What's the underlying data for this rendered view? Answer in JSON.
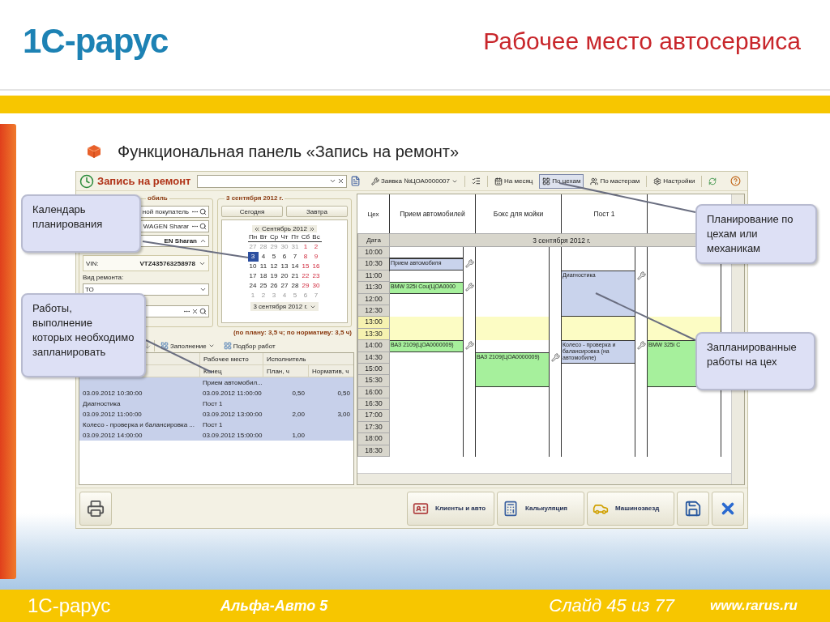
{
  "slide": {
    "logo": "1С-рарус",
    "title": "Рабочее место автосервиса",
    "bullet": "Функциональная панель «Запись на ремонт»"
  },
  "window": {
    "title": "Запись на ремонт",
    "request": "Заявка №ЦОА0000007",
    "views": [
      {
        "label": "На месяц",
        "selected": false
      },
      {
        "label": "По цехам",
        "selected": true
      },
      {
        "label": "По мастерам",
        "selected": false
      }
    ],
    "settings": "Настройки"
  },
  "car": {
    "group_label": "обиль",
    "customer": "ной покупатель",
    "car": "WAGEN Sharar",
    "model": "EN Sharan",
    "vin_label": "VIN:",
    "vin": "VTZ435763258978",
    "repair_label": "Вид ремонта:",
    "repair": "ТО"
  },
  "calendar": {
    "group_label": "3 сентября 2012 г.",
    "buttons": [
      "Сегодня",
      "Завтра"
    ],
    "month": "Сентябрь 2012",
    "weekdays": [
      "Пн",
      "Вт",
      "Ср",
      "Чт",
      "Пт",
      "Сб",
      "Вс"
    ],
    "weeks": [
      [
        {
          "d": "27",
          "kind": "other",
          "selected": false
        },
        {
          "d": "28",
          "kind": "other",
          "selected": false
        },
        {
          "d": "29",
          "kind": "other",
          "selected": false
        },
        {
          "d": "30",
          "kind": "other",
          "selected": false
        },
        {
          "d": "31",
          "kind": "other",
          "selected": false
        },
        {
          "d": "1",
          "kind": "weekend",
          "selected": false
        },
        {
          "d": "2",
          "kind": "weekend",
          "selected": false
        }
      ],
      [
        {
          "d": "3",
          "kind": "work",
          "selected": true
        },
        {
          "d": "4",
          "kind": "work",
          "selected": false
        },
        {
          "d": "5",
          "kind": "work",
          "selected": false
        },
        {
          "d": "6",
          "kind": "work",
          "selected": false
        },
        {
          "d": "7",
          "kind": "work",
          "selected": false
        },
        {
          "d": "8",
          "kind": "weekend",
          "selected": false
        },
        {
          "d": "9",
          "kind": "weekend",
          "selected": false
        }
      ],
      [
        {
          "d": "10",
          "kind": "work",
          "selected": false
        },
        {
          "d": "11",
          "kind": "work",
          "selected": false
        },
        {
          "d": "12",
          "kind": "work",
          "selected": false
        },
        {
          "d": "13",
          "kind": "work",
          "selected": false
        },
        {
          "d": "14",
          "kind": "work",
          "selected": false
        },
        {
          "d": "15",
          "kind": "weekend",
          "selected": false
        },
        {
          "d": "16",
          "kind": "weekend",
          "selected": false
        }
      ],
      [
        {
          "d": "17",
          "kind": "work",
          "selected": false
        },
        {
          "d": "18",
          "kind": "work",
          "selected": false
        },
        {
          "d": "19",
          "kind": "work",
          "selected": false
        },
        {
          "d": "20",
          "kind": "work",
          "selected": false
        },
        {
          "d": "21",
          "kind": "work",
          "selected": false
        },
        {
          "d": "22",
          "kind": "weekend",
          "selected": false
        },
        {
          "d": "23",
          "kind": "weekend",
          "selected": false
        }
      ],
      [
        {
          "d": "24",
          "kind": "work",
          "selected": false
        },
        {
          "d": "25",
          "kind": "work",
          "selected": false
        },
        {
          "d": "26",
          "kind": "work",
          "selected": false
        },
        {
          "d": "27",
          "kind": "work",
          "selected": false
        },
        {
          "d": "28",
          "kind": "work",
          "selected": false
        },
        {
          "d": "29",
          "kind": "weekend",
          "selected": false
        },
        {
          "d": "30",
          "kind": "weekend",
          "selected": false
        }
      ],
      [
        {
          "d": "1",
          "kind": "other",
          "selected": false
        },
        {
          "d": "2",
          "kind": "other",
          "selected": false
        },
        {
          "d": "3",
          "kind": "other",
          "selected": false
        },
        {
          "d": "4",
          "kind": "other",
          "selected": false
        },
        {
          "d": "5",
          "kind": "other",
          "selected": false
        },
        {
          "d": "6",
          "kind": "other",
          "selected": false
        },
        {
          "d": "7",
          "kind": "other",
          "selected": false
        }
      ]
    ],
    "footer": "3 сентября 2012 г."
  },
  "works": {
    "summary": "(по плану: 3,5 ч; по нормативу: 3,5 ч)",
    "tools": [
      "Заполнение",
      "Подбор работ"
    ],
    "header_1": [
      "Рабочее место",
      "Исполнитель"
    ],
    "header_2": [
      "Конец",
      "План, ч",
      "Норматив, ч"
    ],
    "rows": [
      {
        "selected": true,
        "cells": {
          "c2": "Прием автомобил..."
        }
      },
      {
        "selected": true,
        "cells": {
          "c1": "03.09.2012 10:30:00",
          "c2": "03.09.2012 11:00:00",
          "c3": "0,50",
          "c4": "0,50"
        }
      },
      {
        "selected": true,
        "cells": {
          "c1": "Диагностика",
          "c2": "Пост 1"
        }
      },
      {
        "selected": true,
        "cells": {
          "c1": "03.09.2012 11:00:00",
          "c2": "03.09.2012 13:00:00",
          "c3": "2,00",
          "c4": "3,00"
        }
      },
      {
        "selected": true,
        "cells": {
          "c1": "Колесо - проверка и балансировка ...",
          "c2": "Пост 1"
        }
      },
      {
        "selected": true,
        "cells": {
          "c1": "03.09.2012 14:00:00",
          "c2": "03.09.2012 15:00:00",
          "c3": "1,00"
        }
      }
    ]
  },
  "schedule": {
    "corner": "Цех",
    "date_label": "Дата",
    "date": "3 сентября 2012 г.",
    "times": [
      {
        "label": "10:00",
        "lunch": false
      },
      {
        "label": "10:30",
        "lunch": false
      },
      {
        "label": "11:00",
        "lunch": false
      },
      {
        "label": "11:30",
        "lunch": false
      },
      {
        "label": "12:00",
        "lunch": false
      },
      {
        "label": "12:30",
        "lunch": false
      },
      {
        "label": "13:00",
        "lunch": true
      },
      {
        "label": "13:30",
        "lunch": true
      },
      {
        "label": "14:00",
        "lunch": false
      },
      {
        "label": "14:30",
        "lunch": false
      },
      {
        "label": "15:00",
        "lunch": false
      },
      {
        "label": "15:30",
        "lunch": false
      },
      {
        "label": "16:00",
        "lunch": false
      },
      {
        "label": "16:30",
        "lunch": false
      },
      {
        "label": "17:00",
        "lunch": false
      },
      {
        "label": "17:30",
        "lunch": false
      },
      {
        "label": "18:00",
        "lunch": false
      },
      {
        "label": "18:30",
        "lunch": false
      }
    ],
    "shops": [
      {
        "name": "Прием автомобилей",
        "slots": [
          {
            "kind": "free"
          },
          {
            "kind": "work",
            "label": "Прием автомобиля",
            "color": "#c9d3ec",
            "selected": true
          },
          {
            "kind": "free"
          },
          {
            "kind": "work",
            "label": "BMW 325i Cou(ЦОА0000",
            "color": "#a6f09c",
            "selected": false
          },
          {
            "kind": "free"
          },
          {
            "kind": "free"
          },
          {
            "kind": "free"
          },
          {
            "kind": "free"
          },
          {
            "kind": "work",
            "label": "ВАЗ 2109(ЦОА0000009)",
            "color": "#a6f09c",
            "selected": false
          },
          {
            "kind": "free"
          },
          {
            "kind": "free"
          },
          {
            "kind": "free"
          },
          {
            "kind": "free"
          },
          {
            "kind": "free"
          },
          {
            "kind": "free"
          },
          {
            "kind": "free"
          },
          {
            "kind": "free"
          },
          {
            "kind": "free"
          }
        ]
      },
      {
        "name": "Бокс для мойки",
        "slots": [
          {
            "kind": "free"
          },
          {
            "kind": "free"
          },
          {
            "kind": "free"
          },
          {
            "kind": "free"
          },
          {
            "kind": "free"
          },
          {
            "kind": "free"
          },
          {
            "kind": "free"
          },
          {
            "kind": "free"
          },
          {
            "kind": "free"
          },
          {
            "kind": "work",
            "label": "ВАЗ 2109(ЦОА0000009)",
            "color": "#a6f09c",
            "selected": false
          },
          {
            "kind": "more"
          },
          {
            "kind": "more"
          },
          {
            "kind": "free"
          },
          {
            "kind": "free"
          },
          {
            "kind": "free"
          },
          {
            "kind": "free"
          },
          {
            "kind": "free"
          },
          {
            "kind": "free"
          }
        ]
      },
      {
        "name": "Пост 1",
        "slots": [
          {
            "kind": "free"
          },
          {
            "kind": "free"
          },
          {
            "kind": "work",
            "label": "Диагностика",
            "color": "#c9d3ec",
            "selected": false
          },
          {
            "kind": "more"
          },
          {
            "kind": "more"
          },
          {
            "kind": "more"
          },
          {
            "kind": "free"
          },
          {
            "kind": "free"
          },
          {
            "kind": "work",
            "label": "Колесо - проверка и балансировка (на автомобиле)",
            "color": "#c9d3ec",
            "selected": false
          },
          {
            "kind": "more"
          },
          {
            "kind": "free"
          },
          {
            "kind": "free"
          },
          {
            "kind": "free"
          },
          {
            "kind": "free"
          },
          {
            "kind": "free"
          },
          {
            "kind": "free"
          },
          {
            "kind": "free"
          },
          {
            "kind": "free"
          }
        ]
      },
      {
        "slots": [
          {
            "kind": "free"
          },
          {
            "kind": "free"
          },
          {
            "kind": "free"
          },
          {
            "kind": "free"
          },
          {
            "kind": "free"
          },
          {
            "kind": "free"
          },
          {
            "kind": "free"
          },
          {
            "kind": "free"
          },
          {
            "kind": "work",
            "label": "BMW 325i C",
            "color": "#a6f09c",
            "selected": false
          },
          {
            "kind": "more"
          },
          {
            "kind": "more"
          },
          {
            "kind": "more"
          },
          {
            "kind": "free"
          },
          {
            "kind": "free"
          },
          {
            "kind": "free"
          },
          {
            "kind": "free"
          },
          {
            "kind": "free"
          },
          {
            "kind": "free"
          }
        ]
      }
    ]
  },
  "actions": [
    "Клиенты и авто",
    "Калькуляция",
    "Машинозаезд"
  ],
  "callouts": [
    {
      "text": "Календарь планирования"
    },
    {
      "text": "Работы, выполнение которых необходимо запланировать"
    },
    {
      "text": "Планирование по цехам или механикам"
    },
    {
      "text": "Запланированные работы на цех"
    }
  ],
  "footer": {
    "logo": "1С-рарус",
    "product": "Альфа-Авто 5",
    "slide": "Слайд 45 из 77",
    "url": "www.rarus.ru"
  }
}
